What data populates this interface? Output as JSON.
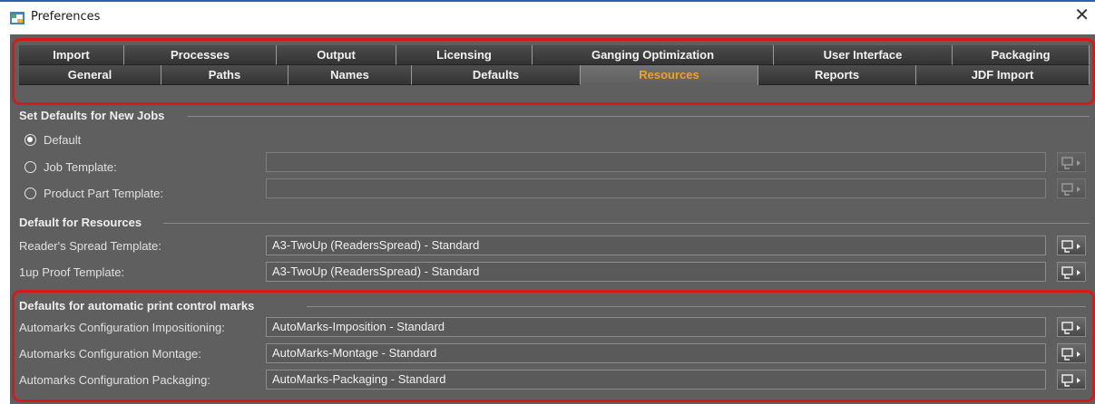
{
  "window": {
    "title": "Preferences",
    "close_glyph": "✕"
  },
  "tabs": {
    "row1": [
      "Import",
      "Processes",
      "Output",
      "Licensing",
      "Ganging Optimization",
      "User Interface",
      "Packaging"
    ],
    "row2": [
      "General",
      "Paths",
      "Names",
      "Defaults",
      "Resources",
      "Reports",
      "JDF Import"
    ],
    "active": "Resources"
  },
  "new_jobs": {
    "heading": "Set Defaults for New Jobs",
    "options": [
      {
        "label": "Default",
        "selected": true
      },
      {
        "label": "Job Template:",
        "selected": false,
        "value": ""
      },
      {
        "label": "Product Part Template:",
        "selected": false,
        "value": ""
      }
    ]
  },
  "resources": {
    "heading": "Default for Resources",
    "rows": [
      {
        "label": "Reader's Spread Template:",
        "value": "A3-TwoUp (ReadersSpread) - Standard"
      },
      {
        "label": "1up Proof Template:",
        "value": "A3-TwoUp (ReadersSpread) - Standard"
      }
    ]
  },
  "automarks": {
    "heading": "Defaults for automatic print control marks",
    "rows": [
      {
        "label": "Automarks Configuration Impositioning:",
        "value": "AutoMarks-Imposition - Standard"
      },
      {
        "label": "Automarks Configuration Montage:",
        "value": "AutoMarks-Montage - Standard"
      },
      {
        "label": "Automarks Configuration Packaging:",
        "value": "AutoMarks-Packaging - Standard"
      }
    ]
  },
  "colors": {
    "active_tab_text": "#f0a020",
    "highlight_border": "#d61a1a",
    "panel_bg": "#5f5f5f"
  },
  "icons": {
    "browse_button": "browse-select-icon",
    "close": "close-icon",
    "app": "preferences-app-icon"
  }
}
